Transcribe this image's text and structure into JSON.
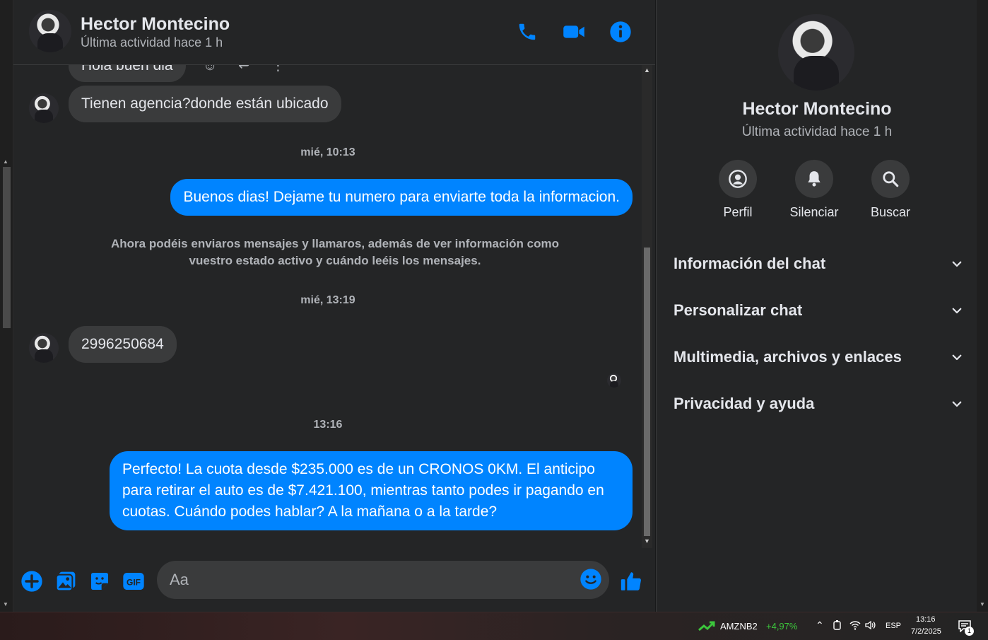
{
  "header": {
    "name": "Hector Montecino",
    "status": "Última actividad hace 1 h"
  },
  "messages": {
    "partial_top": "Hola buen dia",
    "m1": "Tienen agencia?donde están ubicado",
    "ts1": "mié, 10:13",
    "m2": "Buenos dias! Dejame tu numero para enviarte toda la informacion.",
    "notice": "Ahora podéis enviaros mensajes y llamaros, además de ver información como vuestro estado activo y cuándo leéis los mensajes.",
    "ts2": "mié, 13:19",
    "m3": "2996250684",
    "ts3": "13:16",
    "m4": "Perfecto! La cuota desde $235.000 es de un CRONOS 0KM. El anticipo para retirar el auto es de $7.421.100, mientras tanto podes ir pagando en cuotas. Cuándo podes hablar? A la mañana o a la tarde?"
  },
  "composer": {
    "placeholder": "Aa"
  },
  "panel": {
    "name": "Hector Montecino",
    "status": "Última actividad hace 1 h",
    "actions": [
      "Perfil",
      "Silenciar",
      "Buscar"
    ],
    "sections": [
      "Información del chat",
      "Personalizar chat",
      "Multimedia, archivos y enlaces",
      "Privacidad y ayuda"
    ]
  },
  "taskbar": {
    "ticker": "AMZNB2",
    "change": "+4,97%",
    "lang": "ESP",
    "time": "13:16",
    "date": "7/2/2025",
    "notif_count": "1"
  },
  "colors": {
    "accent": "#0084ff",
    "ticker_up": "#3cc63c"
  }
}
